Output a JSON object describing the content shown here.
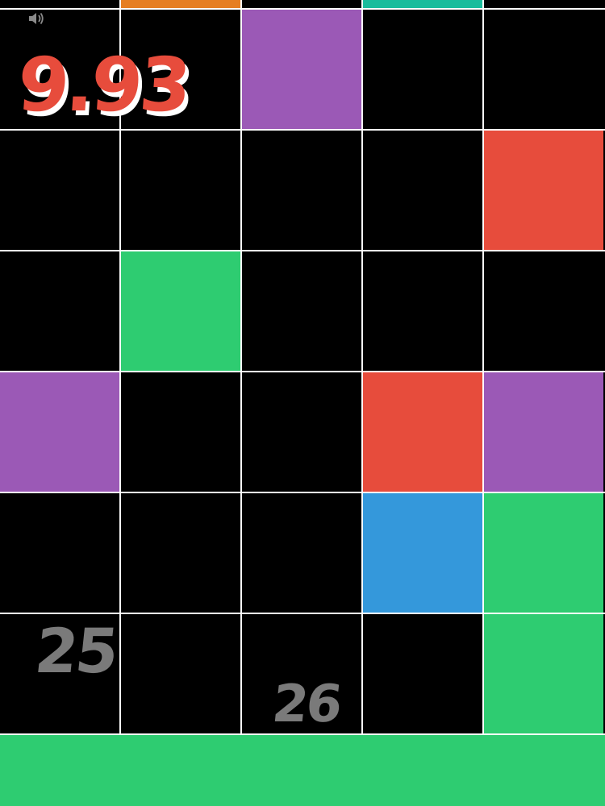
{
  "game": {
    "timer": "9.93",
    "timer_color": "#e74c3c",
    "grid_line_color": "#ffffff",
    "empty_tile_color": "#000000",
    "number_color": "#7a7a7a",
    "tile_numbers": [
      {
        "text": "25",
        "col": 0,
        "row": 5
      },
      {
        "text": "26",
        "col": 2,
        "row": 5
      }
    ],
    "top_strip": [
      {
        "col": 1,
        "color": "#e67e22"
      },
      {
        "col": 3,
        "color": "#1abc9c"
      }
    ],
    "grid": [
      [
        "#000000",
        "#000000",
        "#9b59b6",
        "#000000",
        "#000000"
      ],
      [
        "#000000",
        "#000000",
        "#000000",
        "#000000",
        "#e74c3c"
      ],
      [
        "#000000",
        "#2ecc71",
        "#000000",
        "#000000",
        "#000000"
      ],
      [
        "#9b59b6",
        "#000000",
        "#000000",
        "#e74c3c",
        "#9b59b6"
      ],
      [
        "#000000",
        "#000000",
        "#000000",
        "#3498db",
        "#2ecc71"
      ],
      [
        "#000000",
        "#000000",
        "#000000",
        "#000000",
        "#2ecc71"
      ]
    ],
    "bottom_bar_color": "#2ecc71",
    "sound_icon": "speaker-icon"
  }
}
